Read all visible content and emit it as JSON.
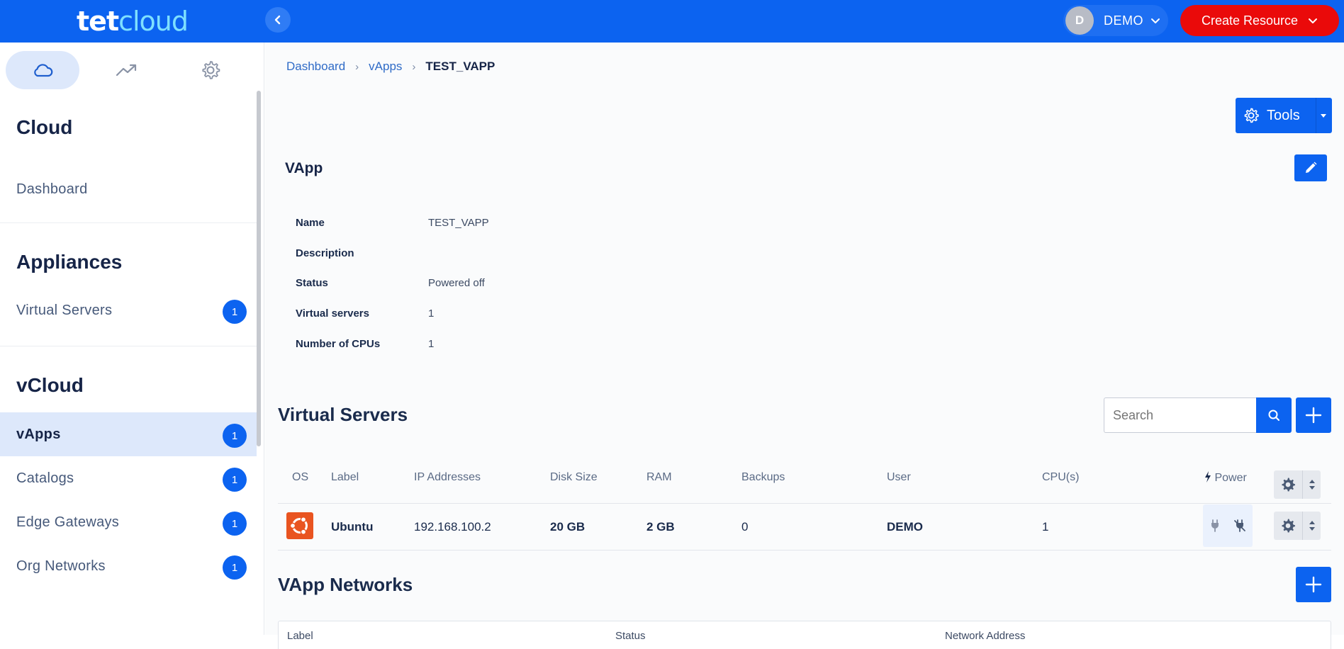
{
  "app": {
    "logo_part1": "tet",
    "logo_part2": "cloud"
  },
  "topbar": {
    "user_initial": "D",
    "user_name": "DEMO",
    "create_label": "Create Resource"
  },
  "sidebar": {
    "tabs": [
      "cloud-icon",
      "trending-icon",
      "settings-icon"
    ],
    "sections": [
      {
        "title": "Cloud",
        "items": [
          {
            "label": "Dashboard",
            "badge": ""
          }
        ]
      },
      {
        "title": "Appliances",
        "items": [
          {
            "label": "Virtual Servers",
            "badge": "1"
          }
        ]
      },
      {
        "title": "vCloud",
        "items": [
          {
            "label": "vApps",
            "badge": "1",
            "active": true
          },
          {
            "label": "Catalogs",
            "badge": "1"
          },
          {
            "label": "Edge Gateways",
            "badge": "1"
          },
          {
            "label": "Org Networks",
            "badge": "1"
          }
        ]
      }
    ]
  },
  "breadcrumb": {
    "items": [
      "Dashboard",
      "vApps"
    ],
    "current": "TEST_VAPP"
  },
  "toolbar": {
    "tools_label": "Tools"
  },
  "vapp": {
    "card_title": "VApp",
    "props": [
      {
        "key": "Name",
        "value": "TEST_VAPP"
      },
      {
        "key": "Description",
        "value": ""
      },
      {
        "key": "Status",
        "value": "Powered off"
      },
      {
        "key": "Virtual servers",
        "value": "1"
      },
      {
        "key": "Number of CPUs",
        "value": "1"
      }
    ]
  },
  "virtual_servers": {
    "title": "Virtual Servers",
    "search_placeholder": "Search",
    "columns": [
      "OS",
      "Label",
      "IP Addresses",
      "Disk Size",
      "RAM",
      "Backups",
      "User",
      "CPU(s)",
      "Power"
    ],
    "rows": [
      {
        "os": "ubuntu-icon",
        "label": "Ubuntu",
        "ip": "192.168.100.2",
        "disk": "20 GB",
        "ram": "2 GB",
        "backups": "0",
        "user": "DEMO",
        "cpus": "1"
      }
    ]
  },
  "vapp_networks": {
    "title": "VApp Networks",
    "columns": [
      "Label",
      "Status",
      "Network Address"
    ]
  },
  "colors": {
    "primary": "#0c63f0",
    "danger": "#ea0a0a",
    "logo_accent": "#7ee0ff"
  }
}
